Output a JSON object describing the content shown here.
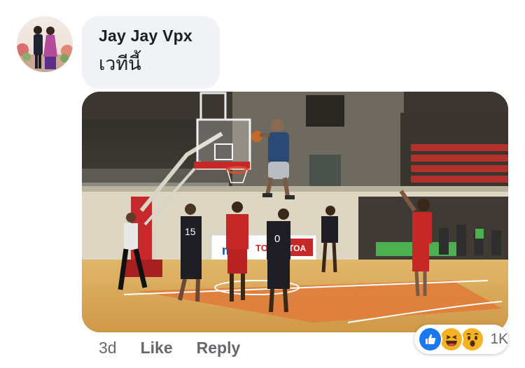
{
  "comment": {
    "author": "Jay Jay Vpx",
    "text": "เวทีนี้",
    "timestamp": "3d",
    "actions": {
      "like": "Like",
      "reply": "Reply"
    },
    "reactions": {
      "types": [
        "like-icon",
        "haha-icon",
        "wow-icon"
      ],
      "count": "1K"
    }
  },
  "photo": {
    "banner_left": "mo",
    "banner_mid": "TOA",
    "banner_right": "TOA",
    "jersey_numbers": [
      "15",
      "0"
    ]
  },
  "colors": {
    "bubble": "#f0f2f5",
    "meta_text": "#65676b",
    "like_blue": "#1877f2",
    "emoji_yellow": "#f7b125"
  }
}
